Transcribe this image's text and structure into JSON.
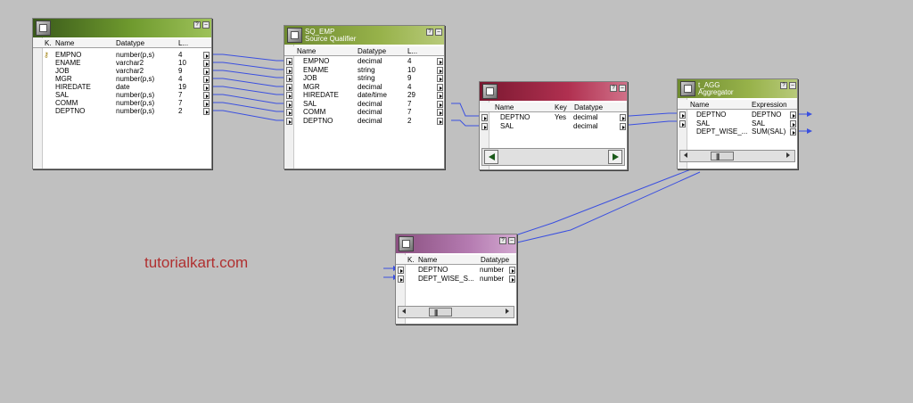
{
  "watermark": "tutorialkart.com",
  "colors": {
    "link_line": "#3a4fe0",
    "source_title": "#5a8a28",
    "router_title": "#b03050",
    "target_title": "#b47ab0"
  },
  "source": {
    "title_line1": "",
    "buttons": [
      "?",
      "–"
    ],
    "headers": [
      "K.",
      "Name",
      "Datatype",
      "L..."
    ],
    "rows": [
      {
        "key": "key-icon",
        "name": "EMPNO",
        "type": "number(p,s)",
        "len": "4"
      },
      {
        "key": "",
        "name": "ENAME",
        "type": "varchar2",
        "len": "10"
      },
      {
        "key": "",
        "name": "JOB",
        "type": "varchar2",
        "len": "9"
      },
      {
        "key": "",
        "name": "MGR",
        "type": "number(p,s)",
        "len": "4"
      },
      {
        "key": "",
        "name": "HIREDATE",
        "type": "date",
        "len": "19"
      },
      {
        "key": "",
        "name": "SAL",
        "type": "number(p,s)",
        "len": "7"
      },
      {
        "key": "",
        "name": "COMM",
        "type": "number(p,s)",
        "len": "7"
      },
      {
        "key": "",
        "name": "DEPTNO",
        "type": "number(p,s)",
        "len": "2"
      }
    ]
  },
  "sq": {
    "title_line1": "SQ_EMP",
    "title_line2": "Source Qualifier",
    "buttons": [
      "?",
      "–"
    ],
    "headers": [
      "Name",
      "Datatype",
      "L..."
    ],
    "rows": [
      {
        "name": "EMPNO",
        "type": "decimal",
        "len": "4"
      },
      {
        "name": "ENAME",
        "type": "string",
        "len": "10"
      },
      {
        "name": "JOB",
        "type": "string",
        "len": "9"
      },
      {
        "name": "MGR",
        "type": "decimal",
        "len": "4"
      },
      {
        "name": "HIREDATE",
        "type": "date/time",
        "len": "29"
      },
      {
        "name": "SAL",
        "type": "decimal",
        "len": "7"
      },
      {
        "name": "COMM",
        "type": "decimal",
        "len": "7"
      },
      {
        "name": "DEPTNO",
        "type": "decimal",
        "len": "2"
      }
    ]
  },
  "sorter": {
    "title_line1": "",
    "title_line2": "",
    "buttons": [
      "?",
      "–"
    ],
    "headers": [
      "Name",
      "Key",
      "Datatype"
    ],
    "rows": [
      {
        "name": "DEPTNO",
        "key": "Yes",
        "type": "decimal"
      },
      {
        "name": "SAL",
        "key": "",
        "type": "decimal"
      }
    ]
  },
  "agg": {
    "title_line1": "t_AGG",
    "title_line2": "Aggregator",
    "buttons": [
      "?",
      "–"
    ],
    "headers": [
      "Name",
      "Expression"
    ],
    "rows": [
      {
        "name": "DEPTNO",
        "expr": "DEPTNO"
      },
      {
        "name": "SAL",
        "expr": "SAL"
      },
      {
        "name": "DEPT_WISE_...",
        "expr": "SUM(SAL)"
      }
    ]
  },
  "target": {
    "title_line1": "",
    "buttons": [
      "?",
      "–"
    ],
    "headers": [
      "K.",
      "Name",
      "Datatype"
    ],
    "rows": [
      {
        "name": "DEPTNO",
        "type": "number"
      },
      {
        "name": "DEPT_WISE_S...",
        "type": "number"
      }
    ]
  }
}
